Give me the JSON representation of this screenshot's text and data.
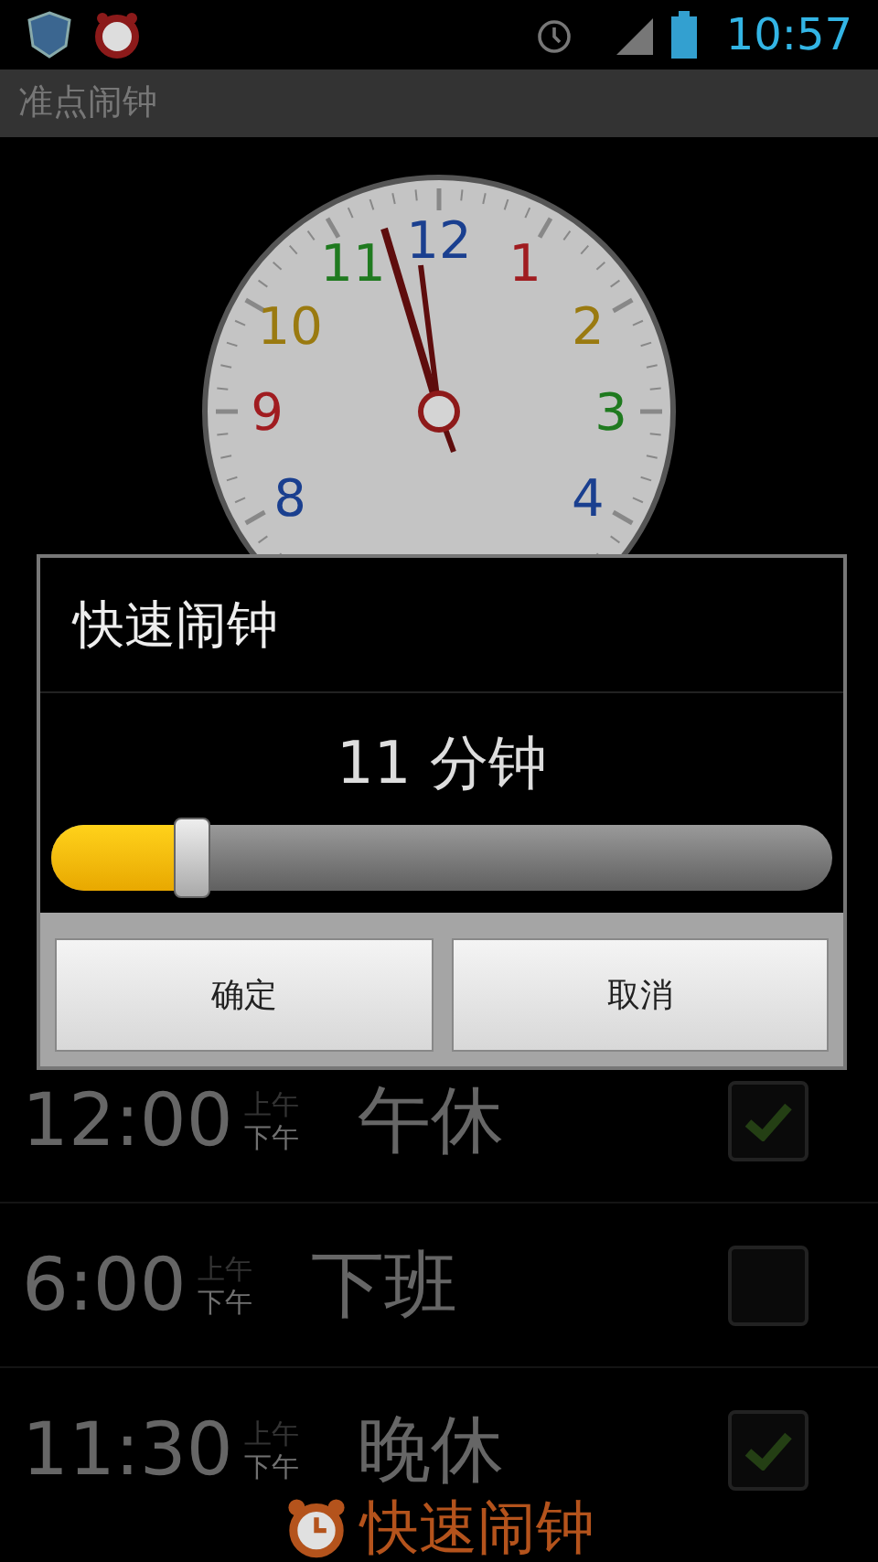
{
  "status_bar": {
    "time": "10:57"
  },
  "app_bar": {
    "title": "准点闹钟"
  },
  "clock": {
    "numerals": [
      {
        "text": "11",
        "color": "#1f7a1f"
      },
      {
        "text": "12",
        "color": "#1a3f8f"
      },
      {
        "text": "1",
        "color": "#a01c20"
      },
      {
        "text": "10",
        "color": "#9a7a10"
      },
      {
        "text": "2",
        "color": "#9a7a10"
      },
      {
        "text": "9",
        "color": "#a01c20"
      },
      {
        "text": "3",
        "color": "#1f7a1f"
      },
      {
        "text": "8",
        "color": "#1a3f8f"
      },
      {
        "text": "4",
        "color": "#1a3f8f"
      }
    ]
  },
  "alarms": [
    {
      "time": "12:00",
      "am": "上午",
      "pm": "下午",
      "pm_selected": true,
      "label": "午休",
      "checked": true
    },
    {
      "time": "6:00",
      "am": "上午",
      "pm": "下午",
      "pm_selected": true,
      "label": "下班",
      "checked": false
    },
    {
      "time": "11:30",
      "am": "上午",
      "pm": "下午",
      "pm_selected": true,
      "label": "晚休",
      "checked": true
    }
  ],
  "dialog": {
    "title": "快速闹钟",
    "reading": "11 分钟",
    "level": 0.18,
    "buttons": [
      "确定",
      "取消"
    ]
  },
  "bottom_bar": {
    "label": "快速闹钟"
  }
}
